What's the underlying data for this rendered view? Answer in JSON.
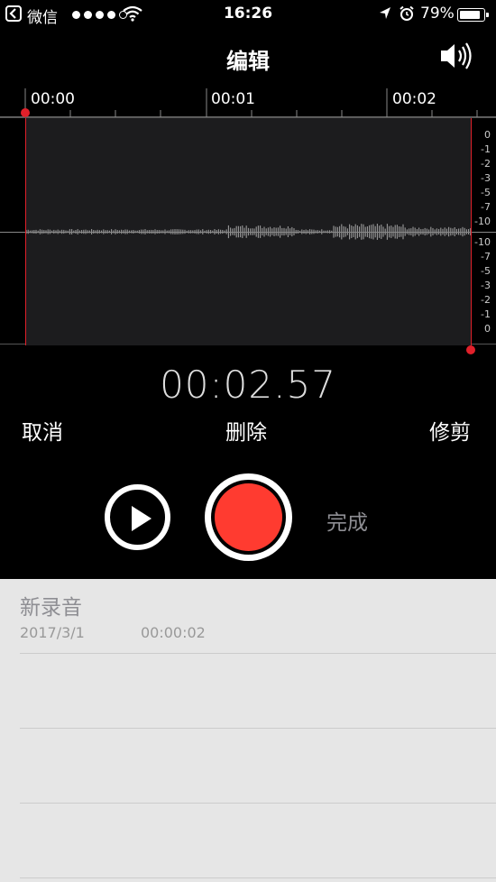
{
  "status_bar": {
    "back_app": "微信",
    "time": "16:26",
    "battery": "79%"
  },
  "nav": {
    "title": "编辑",
    "speaker_icon": "speaker-icon"
  },
  "timeline": {
    "ticks": [
      "00:00",
      "00:01",
      "00:02"
    ]
  },
  "db_scale": [
    "0",
    "-1",
    "-2",
    "-3",
    "-5",
    "-7",
    "-10",
    "-10",
    "-7",
    "-5",
    "-3",
    "-2",
    "-1",
    "0"
  ],
  "elapsed_time": "00:02.57",
  "actions": {
    "cancel": "取消",
    "delete": "删除",
    "trim": "修剪"
  },
  "controls": {
    "done": "完成"
  },
  "recording": {
    "name": "新录音",
    "date": "2017/3/1",
    "duration": "00:00:02"
  },
  "colors": {
    "accent_red": "#ff3b30",
    "handle_red": "#e0202a"
  }
}
